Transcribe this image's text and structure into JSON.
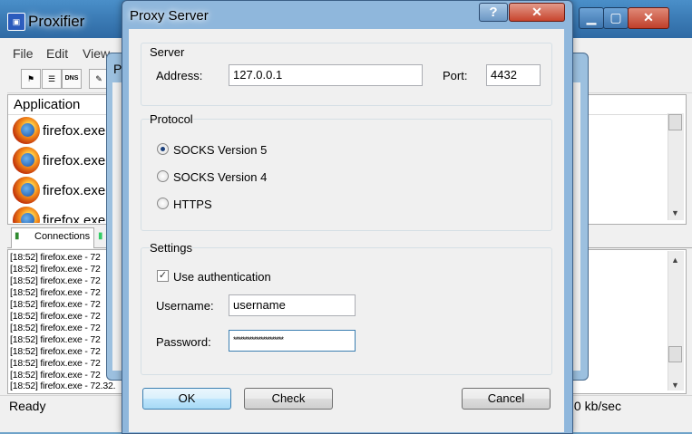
{
  "main_window": {
    "title": "Proxifier",
    "app_icon": "proxifier-icon",
    "menu": [
      "File",
      "Edit",
      "View"
    ],
    "toolbar_icons": [
      "profile-icon",
      "rules-icon",
      "dns-icon",
      "log-icon"
    ],
    "dns_label": "DNS",
    "app_header": "Application",
    "apps": [
      "firefox.exe",
      "firefox.exe",
      "firefox.exe",
      "firefox.exe"
    ],
    "tabs": [
      "Connections"
    ],
    "log_lines": [
      "[18:52] firefox.exe - 72",
      "[18:52] firefox.exe - 72",
      "[18:52] firefox.exe - 72",
      "[18:52] firefox.exe - 72",
      "[18:52] firefox.exe - 72",
      "[18:52] firefox.exe - 72",
      "[18:52] firefox.exe - 72",
      "[18:52] firefox.exe - 72",
      "[18:52] firefox.exe - 72",
      "[18:52] firefox.exe - 72",
      "[18:52] firefox.exe - 72",
      "[18:52] firefox.exe - 72.32."
    ],
    "status_left": "Ready",
    "status_right": "s 0 kb/sec",
    "mid_dialog_fragment": "P"
  },
  "dialog": {
    "title": "Proxy Server",
    "help_label": "?",
    "close_label": "✕",
    "server": {
      "group_label": "Server",
      "address_label": "Address:",
      "address_value": "127.0.0.1",
      "port_label": "Port:",
      "port_value": "4432"
    },
    "protocol": {
      "group_label": "Protocol",
      "options": [
        "SOCKS Version 5",
        "SOCKS Version 4",
        "HTTPS"
      ],
      "selected": "SOCKS Version 5"
    },
    "settings": {
      "group_label": "Settings",
      "use_auth_label": "Use authentication",
      "use_auth_checked": true,
      "username_label": "Username:",
      "username_value": "username",
      "password_label": "Password:",
      "password_value": "**********************"
    },
    "buttons": {
      "ok": "OK",
      "check": "Check",
      "cancel": "Cancel"
    }
  },
  "colors": {
    "titlebar_blue": "#3b7bb5",
    "close_red": "#c8452e",
    "radio_dot": "#1a3f7a"
  }
}
